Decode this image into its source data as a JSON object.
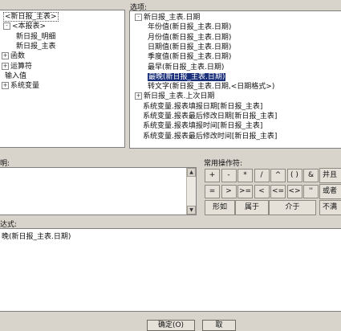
{
  "left_tree": {
    "items": [
      {
        "label": "<新日报_主表>",
        "toggle": ""
      },
      {
        "label": "<本报表>",
        "toggle": "-"
      },
      {
        "label": "新日报_明细",
        "toggle": ""
      },
      {
        "label": "新日报_主表",
        "toggle": ""
      },
      {
        "label": "函数",
        "toggle": "+"
      },
      {
        "label": "运算符",
        "toggle": "+"
      },
      {
        "label": "输入值",
        "toggle": ""
      },
      {
        "label": "系统变量",
        "toggle": "+"
      }
    ]
  },
  "options": {
    "label": "选项:",
    "items": [
      {
        "label": "新日报_主表.日期",
        "toggle": "-"
      },
      {
        "label": "年份值(新日报_主表.日期)",
        "toggle": ""
      },
      {
        "label": "月份值(新日报_主表.日期)",
        "toggle": ""
      },
      {
        "label": "日期值(新日报_主表.日期)",
        "toggle": ""
      },
      {
        "label": "季度值(新日报_主表.日期)",
        "toggle": ""
      },
      {
        "label": "最早(新日报_主表.日期)",
        "toggle": ""
      },
      {
        "label": "最晚(新日报_主表.日期)",
        "toggle": ""
      },
      {
        "label": "转文字(新日报_主表.日期,<日期格式>)",
        "toggle": ""
      },
      {
        "label": "新日报_主表.上次日期",
        "toggle": "+"
      },
      {
        "label": "系统变量.报表填报日期[新日报_主表]",
        "toggle": ""
      },
      {
        "label": "系统变量.报表最后修改日期[新日报_主表]",
        "toggle": ""
      },
      {
        "label": "系统变量.报表填报时间[新日报_主表]",
        "toggle": ""
      },
      {
        "label": "系统变量.报表最后修改时间[新日报_主表]",
        "toggle": ""
      }
    ]
  },
  "description": {
    "label": "明:"
  },
  "operators": {
    "label": "常用操作符:",
    "row1": [
      "+",
      "-",
      "*",
      "/",
      "^",
      "( )",
      "&"
    ],
    "row2": [
      "=",
      ">",
      ">=",
      "<",
      "<=",
      "<>",
      "''"
    ],
    "row3": [
      "形如",
      "属于",
      "介于"
    ],
    "side": [
      "并且",
      "或者",
      "不满足"
    ]
  },
  "formula": {
    "label": "达式:",
    "value": "晚(新日报_主表.日期)"
  },
  "buttons": {
    "ok": "确定(O)",
    "cancel": "取"
  }
}
